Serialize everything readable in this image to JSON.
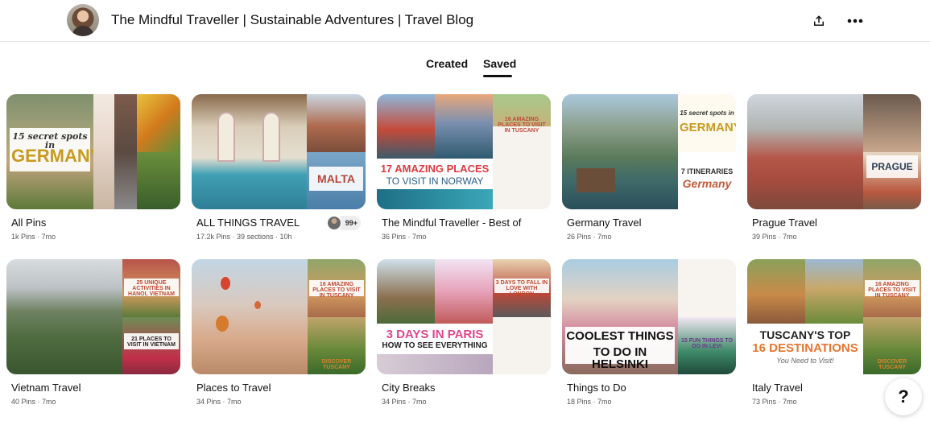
{
  "header": {
    "board_title": "The Mindful Traveller | Sustainable Adventures | Travel Blog",
    "share_icon": "share-icon",
    "more_icon": "more-options-icon"
  },
  "tabs": [
    {
      "label": "Created",
      "active": false
    },
    {
      "label": "Saved",
      "active": true
    }
  ],
  "boards": [
    {
      "name": "All Pins",
      "meta": "1k Pins · 7mo",
      "cover_text": [
        "15 secret spots in",
        "GERMANY"
      ]
    },
    {
      "name": "ALL THINGS TRAVEL",
      "meta": "17.2k Pins · 39 sections · 10h",
      "collaborators": "99+",
      "cover_text": [
        "MALTA"
      ]
    },
    {
      "name": "The Mindful Traveller - Best of",
      "meta": "36 Pins · 7mo",
      "cover_text": [
        "17 AMAZING PLACES",
        "TO VISIT IN NORWAY",
        "16 AMAZING PLACES TO VISIT IN TUSCANY"
      ]
    },
    {
      "name": "Germany Travel",
      "meta": "26 Pins · 7mo",
      "cover_text": [
        "15 secret spots in",
        "GERMANY",
        "7 ITINERARIES",
        "Germany"
      ]
    },
    {
      "name": "Prague Travel",
      "meta": "39 Pins · 7mo",
      "cover_text": [
        "PRAGUE"
      ]
    },
    {
      "name": "Vietnam Travel",
      "meta": "40 Pins · 7mo",
      "cover_text": [
        "25 UNIQUE ACTIVITIES IN HANOI, VIETNAM",
        "21 PLACES TO VISIT IN VIETNAM"
      ]
    },
    {
      "name": "Places to Travel",
      "meta": "34 Pins · 7mo",
      "cover_text": [
        "16 AMAZING PLACES TO VISIT IN TUSCANY",
        "DISCOVER TUSCANY"
      ]
    },
    {
      "name": "City Breaks",
      "meta": "34 Pins · 7mo",
      "cover_text": [
        "3 DAYS IN PARIS",
        "HOW TO SEE EVERYTHING",
        "3 DAYS TO FALL IN LOVE WITH LONDON"
      ]
    },
    {
      "name": "Things to Do",
      "meta": "18 Pins · 7mo",
      "cover_text": [
        "COOLEST THINGS",
        "TO DO IN HELSINKI",
        "15 FUN THINGS TO DO IN LEVI"
      ]
    },
    {
      "name": "Italy Travel",
      "meta": "73 Pins · 7mo",
      "cover_text": [
        "TUSCANY'S TOP",
        "16 DESTINATIONS",
        "You Need to Visit!",
        "16 AMAZING PLACES TO VISIT IN TUSCANY",
        "DISCOVER TUSCANY"
      ]
    }
  ],
  "help": {
    "label": "?"
  }
}
